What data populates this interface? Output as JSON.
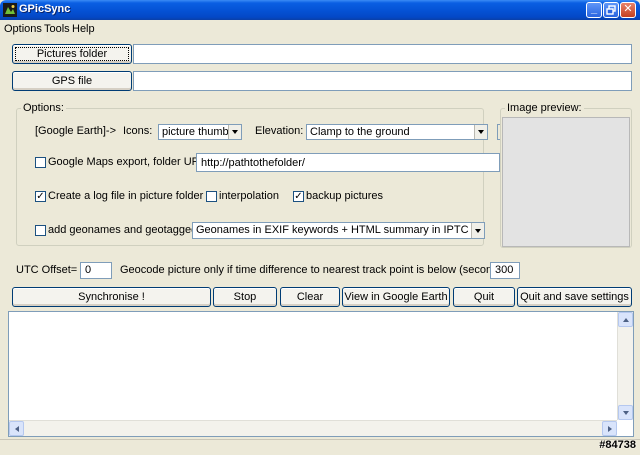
{
  "window": {
    "title": "GPicSync"
  },
  "menu": {
    "items": [
      {
        "label": "Options"
      },
      {
        "label": "Tools"
      },
      {
        "label": "Help"
      }
    ]
  },
  "files": {
    "pictures_button": "Pictures folder",
    "pictures_value": "",
    "gps_button": "GPS file",
    "gps_value": ""
  },
  "options": {
    "legend": "Options:",
    "google_earth_label": "[Google Earth]->",
    "icons_label": "Icons:",
    "icons_value": "picture thumb",
    "elevation_label": "Elevation:",
    "elevation_value": "Clamp to the ground",
    "gmaps_label": "Google Maps export, folder URL=",
    "gmaps_checked": false,
    "gmaps_url": "http://pathtothefolder/",
    "logfile_label": "Create a log file in picture folder",
    "logfile_checked": true,
    "interpolation_label": "interpolation",
    "interpolation_checked": false,
    "backup_label": "backup pictures",
    "backup_checked": true,
    "geonames_label": "add geonames and geotagged",
    "geonames_checked": false,
    "geonames_value": "Geonames in EXIF keywords + HTML summary in IPTC caption"
  },
  "preview": {
    "legend": "Image preview:"
  },
  "utc": {
    "label": "UTC Offset=",
    "value": "0",
    "geocode_label": "Geocode picture only if time difference to nearest track point is below (seconds)=",
    "geocode_value": "300"
  },
  "actions": {
    "synchronise": "Synchronise !",
    "stop": "Stop",
    "clear": "Clear",
    "view_ge": "View in Google Earth",
    "quit": "Quit",
    "quit_save": "Quit and save settings"
  },
  "watermark": "#84738",
  "colors": {
    "titlebar": "#0553d6",
    "face": "#ece9d8",
    "input_border": "#7f9db9"
  }
}
